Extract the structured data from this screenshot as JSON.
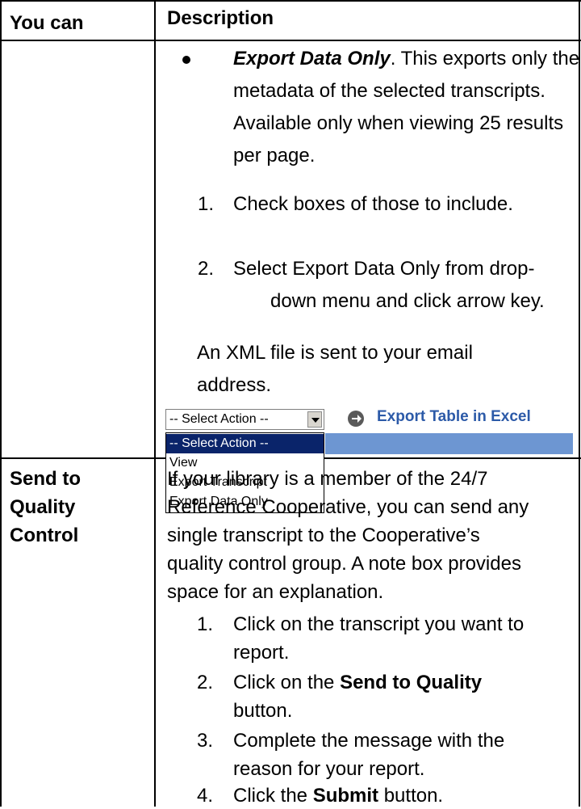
{
  "header": {
    "col1": "You can",
    "col2": "Description"
  },
  "row1": {
    "bullet_title": "Export Data Only",
    "bullet_rest_1": ". This exports only the",
    "bullet_line_2": "metadata of the selected transcripts.",
    "bullet_line_3": "Available only when viewing 25 results",
    "bullet_line_4": "per page.",
    "steps": [
      {
        "num": "1.",
        "lines": [
          "Check boxes of those to include."
        ]
      },
      {
        "num": "2.",
        "lines": [
          "Select Export Data Only from drop-",
          "down menu and click arrow key."
        ]
      }
    ],
    "note_line_1": "An XML file is sent to your email",
    "note_line_2": "address.",
    "screenshot": {
      "select_value": "-- Select Action --",
      "export_link": "Export Table in Excel",
      "options": [
        "-- Select Action --",
        "View",
        "Export Transcript",
        "Export Data Only"
      ],
      "highlight_color": "#0a246a"
    }
  },
  "row2": {
    "label_lines": [
      "Send to",
      "Quality",
      "Control"
    ],
    "para_lines": [
      "If your library is a member of the 24/7",
      "Reference Cooperative, you can send any",
      "single transcript to the Cooperative’s",
      "quality control group.  A note box provides",
      "space for an explanation."
    ],
    "step1": {
      "num": "1.",
      "l1": "Click on the transcript you want to",
      "l2": "report."
    },
    "step2": {
      "num": "2.",
      "pre": "Click on the ",
      "bold": "Send to Quality",
      "l2": "button."
    },
    "step3": {
      "num": "3.",
      "l1": "Complete the message with the",
      "l2": "reason for your report."
    },
    "step4": {
      "num": "4.",
      "pre": "Click the ",
      "bold": "Submit",
      "post": " button."
    }
  }
}
